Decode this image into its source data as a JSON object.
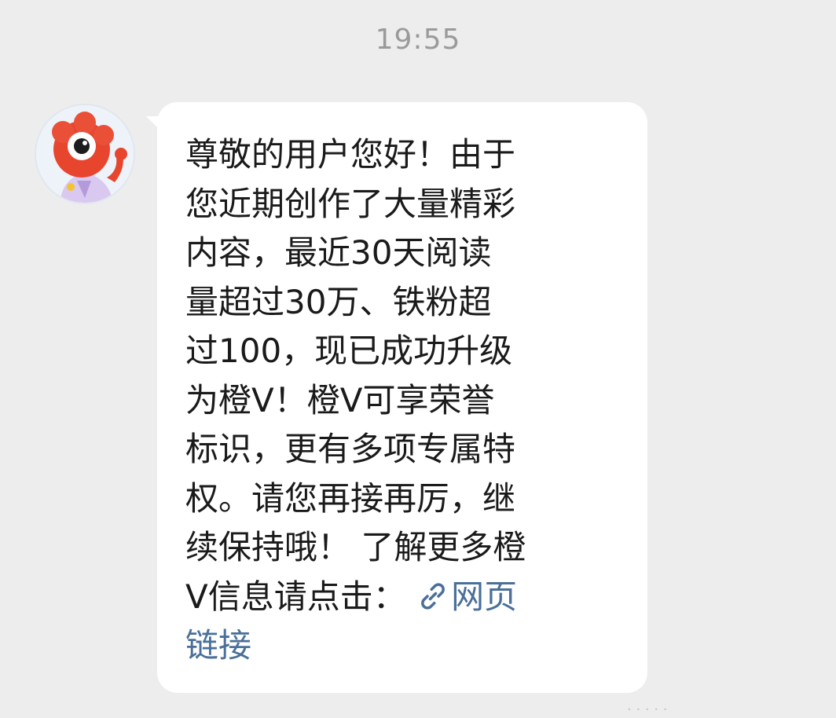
{
  "chat": {
    "timestamp": "19:55",
    "message": {
      "lines": [
        "尊敬的用户您好！由于",
        "您近期创作了大量精彩",
        "内容，最近30天阅读",
        "量超过30万、铁粉超",
        "过100，现已成功升级",
        "为橙V！橙V可享荣誉",
        "标识，更有多项专属特",
        "权。请您再接再厉，继",
        "续保持哦！ 了解更多橙",
        "V信息请点击："
      ],
      "link_label_part1": "网页",
      "link_label_part2": "链接",
      "link_icon": "link-icon"
    },
    "sender_avatar_icon": "weibo-mascot-avatar"
  },
  "colors": {
    "background": "#ededed",
    "bubble": "#ffffff",
    "text": "#1a1a1a",
    "link": "#4a6f99",
    "timestamp": "#9a9a9a"
  }
}
